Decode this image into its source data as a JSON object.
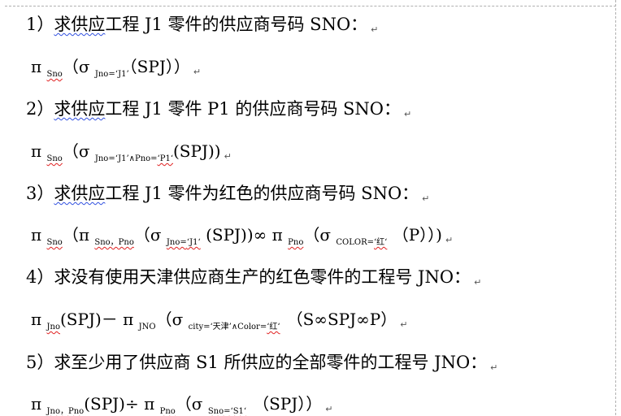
{
  "q1": {
    "num": "1）",
    "w": "求供应",
    "rest": "工程 J1 零件的供应商号码 SNO：",
    "mark": "↵"
  },
  "f1": {
    "pi": "π",
    "pi_sub": "Sno",
    "open": "（σ",
    "sel_sub": "Jno=‘J1’",
    "rest": "（SPJ））",
    "mark": "↵"
  },
  "q2": {
    "num": "2）",
    "w": "求供应",
    "rest": "工程 J1 零件 P1 的供应商号码 SNO：",
    "mark": "↵"
  },
  "f2": {
    "pi": "π",
    "pi_sub": "Sno",
    "open": "（σ",
    "sel_sub_a": "Jno=‘J1’∧Pno=",
    "sel_sub_b": "‘P1‘",
    "rest": "(SPJ))",
    "mark": "↵"
  },
  "q3": {
    "num": "3）",
    "w": "求供应",
    "rest": "工程 J1 零件为红色的供应商号码 SNO：",
    "mark": "↵"
  },
  "f3": {
    "pi": "π",
    "pi_sub": "Sno",
    "open": "（π",
    "pi2_sub": "Sno，Pno",
    "mid": "（σ",
    "sel_sub_a": "Jno=",
    "sel_sub_b": "‘J1‘",
    "join": "(SPJ))∞ π",
    "pi3_sub": "Pno",
    "mid2": "（σ",
    "sel2_sub_a": "COLOR=",
    "sel2_sub_b": "‘红‘",
    "rest": "（P））)",
    "mark": "↵"
  },
  "q4": {
    "num": "4）",
    "text": "求没有使用天津供应商生产的红色零件的工程号 JNO：",
    "mark": "↵"
  },
  "f4": {
    "pi": "π",
    "pi_sub": "Jno",
    "mid": "(SPJ)－ π",
    "pi2_sub": "JNO",
    "open": "（σ",
    "sel_sub_a": "city=‘天津’∧Color=",
    "sel_sub_b": "‘红‘",
    "rest": "（S∞SPJ∞P）",
    "mark": "↵"
  },
  "q5": {
    "num": "5）",
    "text": "求至少用了供应商 S1 所供应的全部零件的工程号 JNO：",
    "mark": "↵"
  },
  "f5": {
    "pi": "π",
    "pi_sub": "Jno，Pno",
    "mid": "(SPJ)÷ π",
    "pi2_sub": "Pno",
    "open": "（σ",
    "sel_sub_a": "Sno=",
    "sel_sub_b": "‘S1‘",
    "rest": "（SPJ））",
    "mark": "↵"
  }
}
